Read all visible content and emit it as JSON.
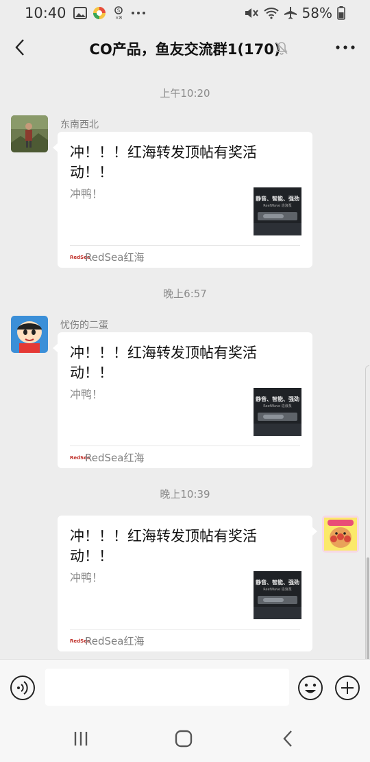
{
  "status_bar": {
    "time": "10:40",
    "battery": "58%",
    "icons": [
      "image-icon",
      "app-icon",
      "music-icon",
      "more-dots-icon",
      "mute-icon",
      "wifi-icon",
      "airplane-icon",
      "battery-icon"
    ]
  },
  "header": {
    "title": "CO产品，鱼友交流群1(170)",
    "icons": [
      "back-icon",
      "mute-bell-icon",
      "more-icon"
    ]
  },
  "messages": [
    {
      "time": "上午10:20",
      "sender": "东南西北",
      "side": "left",
      "title": "冲！！！红海转发顶帖有奖活动！！",
      "desc": "冲鸭！",
      "thumb_text": "静音、智能、强劲",
      "thumb_sub": "ReefWave 造浪泵",
      "source_logo": "RedSea",
      "source": "RedSea红海"
    },
    {
      "time": "晚上6:57",
      "sender": "忧伤的二蛋",
      "side": "left",
      "title": "冲！！！红海转发顶帖有奖活动！！",
      "desc": "冲鸭！",
      "thumb_text": "静音、智能、强劲",
      "thumb_sub": "ReefWave 造浪泵",
      "source_logo": "RedSea",
      "source": "RedSea红海"
    },
    {
      "time": "晚上10:39",
      "sender": "",
      "side": "right",
      "title": "冲！！！红海转发顶帖有奖活动！！",
      "desc": "冲鸭！",
      "thumb_text": "静音、智能、强劲",
      "thumb_sub": "ReefWave 造浪泵",
      "source_logo": "RedSea",
      "source": "RedSea红海"
    }
  ],
  "input_bar": {
    "value": "",
    "placeholder": "",
    "icons": [
      "voice-icon",
      "emoji-icon",
      "plus-icon"
    ]
  },
  "colors": {
    "background": "#ededed",
    "card": "#ffffff",
    "muted_text": "#8a8a8a"
  }
}
